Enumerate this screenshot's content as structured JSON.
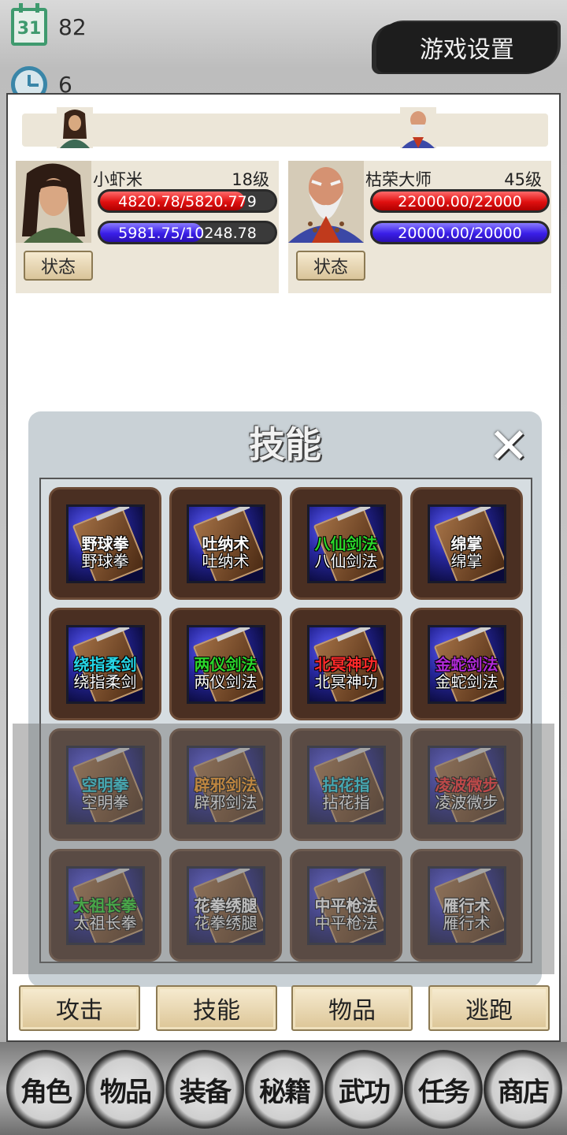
{
  "topbar": {
    "day_icon": "calendar-icon",
    "day_icon_text": "31",
    "day_count": "82",
    "clock_icon": "clock-icon",
    "time_count": "6",
    "settings_label": "游戏设置"
  },
  "player": {
    "name": "小虾米",
    "level": "18级",
    "hp_text": "4820.78/5820.779",
    "hp_fraction": 0.828,
    "mp_text": "5981.75/10248.78",
    "mp_fraction": 0.584,
    "status_label": "状态"
  },
  "enemy": {
    "name": "枯荣大师",
    "level": "45级",
    "hp_text": "22000.00/22000",
    "hp_fraction": 1.0,
    "mp_text": "20000.00/20000",
    "mp_fraction": 1.0,
    "status_label": "状态"
  },
  "skill_panel": {
    "title": "技能",
    "close_icon": "close-icon",
    "skills": [
      {
        "name": "野球拳",
        "sub": "野球拳",
        "color": "#ffffff"
      },
      {
        "name": "吐纳术",
        "sub": "吐纳术",
        "color": "#ffffff"
      },
      {
        "name": "八仙剑法",
        "sub": "八仙剑法",
        "color": "#2bd62b"
      },
      {
        "name": "绵掌",
        "sub": "绵掌",
        "color": "#ffffff"
      },
      {
        "name": "绕指柔剑",
        "sub": "绕指柔剑",
        "color": "#27d6e6"
      },
      {
        "name": "两仪剑法",
        "sub": "两仪剑法",
        "color": "#2bd62b"
      },
      {
        "name": "北冥神功",
        "sub": "北冥神功",
        "color": "#ff2a2a"
      },
      {
        "name": "金蛇剑法",
        "sub": "金蛇剑法",
        "color": "#b02ad6"
      },
      {
        "name": "空明拳",
        "sub": "空明拳",
        "color": "#27d6e6"
      },
      {
        "name": "辟邪剑法",
        "sub": "辟邪剑法",
        "color": "#ff9a1a"
      },
      {
        "name": "拈花指",
        "sub": "拈花指",
        "color": "#27d6e6"
      },
      {
        "name": "凌波微步",
        "sub": "凌波微步",
        "color": "#ff2a2a"
      },
      {
        "name": "太祖长拳",
        "sub": "太祖长拳",
        "color": "#2bd62b"
      },
      {
        "name": "花拳绣腿",
        "sub": "花拳绣腿",
        "color": "#ffffff"
      },
      {
        "name": "中平枪法",
        "sub": "中平枪法",
        "color": "#ffffff"
      },
      {
        "name": "雁行术",
        "sub": "雁行术",
        "color": "#ffffff"
      }
    ]
  },
  "actions": {
    "attack": "攻击",
    "skill": "技能",
    "item": "物品",
    "flee": "逃跑"
  },
  "nav": [
    "角色",
    "物品",
    "装备",
    "秘籍",
    "武功",
    "任务",
    "商店"
  ]
}
